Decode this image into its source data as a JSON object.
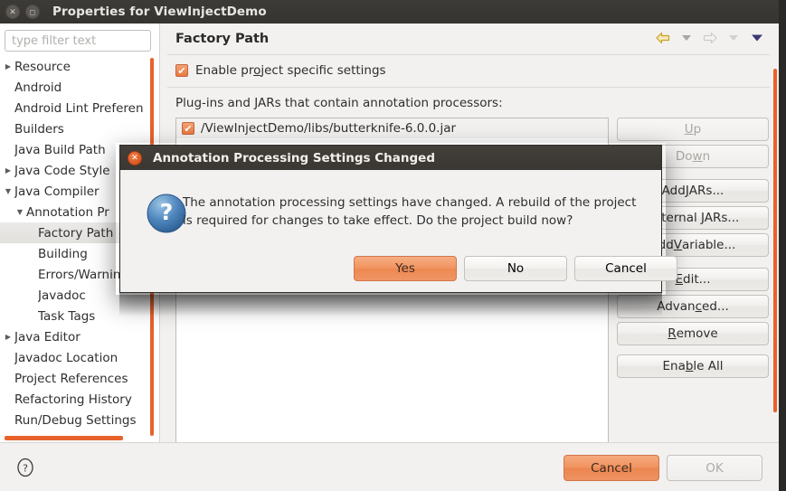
{
  "window": {
    "title": "Properties for ViewInjectDemo",
    "close_icon": "close-icon",
    "maximize_icon": "maximize-icon"
  },
  "sidebar": {
    "filter": {
      "placeholder": "type filter text",
      "value": "",
      "clear_icon": "clear-icon"
    },
    "items": [
      {
        "label": "Resource",
        "indent": 0,
        "arrow": "collapsed",
        "selected": false
      },
      {
        "label": "Android",
        "indent": 0,
        "arrow": "none",
        "selected": false
      },
      {
        "label": "Android Lint Preferen",
        "indent": 0,
        "arrow": "none",
        "selected": false
      },
      {
        "label": "Builders",
        "indent": 0,
        "arrow": "none",
        "selected": false
      },
      {
        "label": "Java Build Path",
        "indent": 0,
        "arrow": "none",
        "selected": false
      },
      {
        "label": "Java Code Style",
        "indent": 0,
        "arrow": "collapsed",
        "selected": false
      },
      {
        "label": "Java Compiler",
        "indent": 0,
        "arrow": "expanded",
        "selected": false
      },
      {
        "label": "Annotation Pr",
        "indent": 1,
        "arrow": "expanded",
        "selected": false
      },
      {
        "label": "Factory Path",
        "indent": 2,
        "arrow": "none",
        "selected": true
      },
      {
        "label": "Building",
        "indent": 2,
        "arrow": "none",
        "selected": false
      },
      {
        "label": "Errors/Warnin",
        "indent": 2,
        "arrow": "none",
        "selected": false
      },
      {
        "label": "Javadoc",
        "indent": 2,
        "arrow": "none",
        "selected": false
      },
      {
        "label": "Task Tags",
        "indent": 2,
        "arrow": "none",
        "selected": false
      },
      {
        "label": "Java Editor",
        "indent": 0,
        "arrow": "collapsed",
        "selected": false
      },
      {
        "label": "Javadoc Location",
        "indent": 0,
        "arrow": "none",
        "selected": false
      },
      {
        "label": "Project References",
        "indent": 0,
        "arrow": "none",
        "selected": false
      },
      {
        "label": "Refactoring History",
        "indent": 0,
        "arrow": "none",
        "selected": false
      },
      {
        "label": "Run/Debug Settings",
        "indent": 0,
        "arrow": "none",
        "selected": false
      }
    ]
  },
  "page": {
    "title": "Factory Path",
    "nav": {
      "back_icon": "back-arrow-icon",
      "back_menu_icon": "chevron-down-icon",
      "forward_icon": "forward-arrow-icon",
      "forward_menu_icon": "chevron-down-icon",
      "menu_icon": "chevron-down-icon"
    },
    "enable_checkbox": {
      "label": "Enable project specific settings",
      "checked": true,
      "mnemonic": "o"
    },
    "plugins_label": "Plug-ins and JARs that contain annotation processors:",
    "list": {
      "rows": [
        {
          "label": "/ViewInjectDemo/libs/butterknife-6.0.0.jar",
          "checked": true
        }
      ]
    },
    "buttons": [
      {
        "label": "Up",
        "mnemonic": "U",
        "enabled": false
      },
      {
        "label": "Down",
        "mnemonic": "w",
        "enabled": false
      },
      {
        "label": "Add JARs...",
        "mnemonic": "J",
        "enabled": true
      },
      {
        "label": "External JARs...",
        "mnemonic": "x",
        "enabled": true
      },
      {
        "label": "Add Variable...",
        "mnemonic": "V",
        "enabled": true
      },
      {
        "label": "Edit...",
        "mnemonic": "E",
        "enabled": true
      },
      {
        "label": "Advanced...",
        "mnemonic": "c",
        "enabled": true
      },
      {
        "label": "Remove",
        "mnemonic": "R",
        "enabled": true
      },
      {
        "label": "Enable All",
        "mnemonic": "b",
        "enabled": true
      }
    ]
  },
  "footer": {
    "help_icon": "help-icon",
    "cancel_label": "Cancel",
    "ok_label": "OK",
    "ok_enabled": false
  },
  "dialog": {
    "title": "Annotation Processing Settings Changed",
    "close_icon": "close-icon",
    "icon": "question-icon",
    "message": "The annotation processing settings have changed. A rebuild of the project is required for changes to take effect. Do the project build now?",
    "buttons": [
      {
        "label": "Yes",
        "primary": true
      },
      {
        "label": "No",
        "primary": false
      },
      {
        "label": "Cancel",
        "primary": false
      }
    ]
  },
  "colors": {
    "accent_orange": "#e8622b",
    "primary_button": "#ef8f5a",
    "titlebar": "#3a3733",
    "selection": "#e8e6e3"
  }
}
